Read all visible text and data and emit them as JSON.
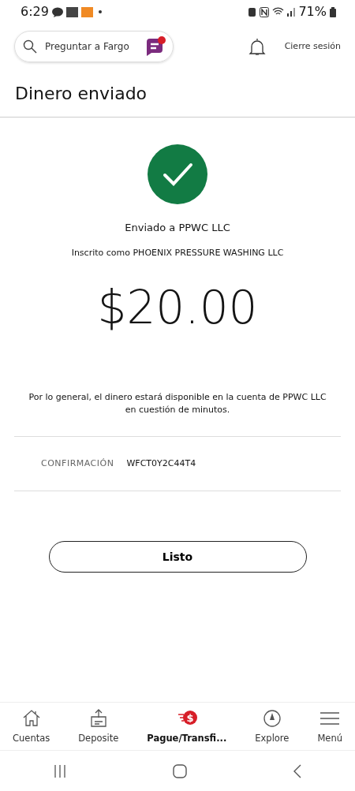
{
  "status_bar": {
    "time": "6:29",
    "battery": "71%"
  },
  "header": {
    "search": {
      "placeholder": "Preguntar a Fargo"
    },
    "has_notification_dot": true,
    "logout": "Cierre sesión"
  },
  "title": "Dinero enviado",
  "confirmation": {
    "sent_to": "Enviado a PPWC LLC",
    "registered_as": "Inscrito como PHOENIX PRESSURE WASHING LLC",
    "amount": "$20.00",
    "note": "Por lo general, el dinero estará disponible en la cuenta de PPWC LLC en cuestión de minutos.",
    "label": "CONFIRMACIÓN",
    "code": "WFCT0Y2C44T4"
  },
  "done_button": "Listo",
  "bottom_nav": [
    {
      "kind": "home",
      "label": "Cuentas",
      "selected": false
    },
    {
      "kind": "deposit",
      "label": "Deposite",
      "selected": false
    },
    {
      "kind": "pay",
      "label": "Pague/Transfi...",
      "badge": "$",
      "selected": true
    },
    {
      "kind": "explore",
      "label": "Explore",
      "selected": false
    },
    {
      "kind": "menu",
      "label": "Menú",
      "selected": false
    }
  ]
}
